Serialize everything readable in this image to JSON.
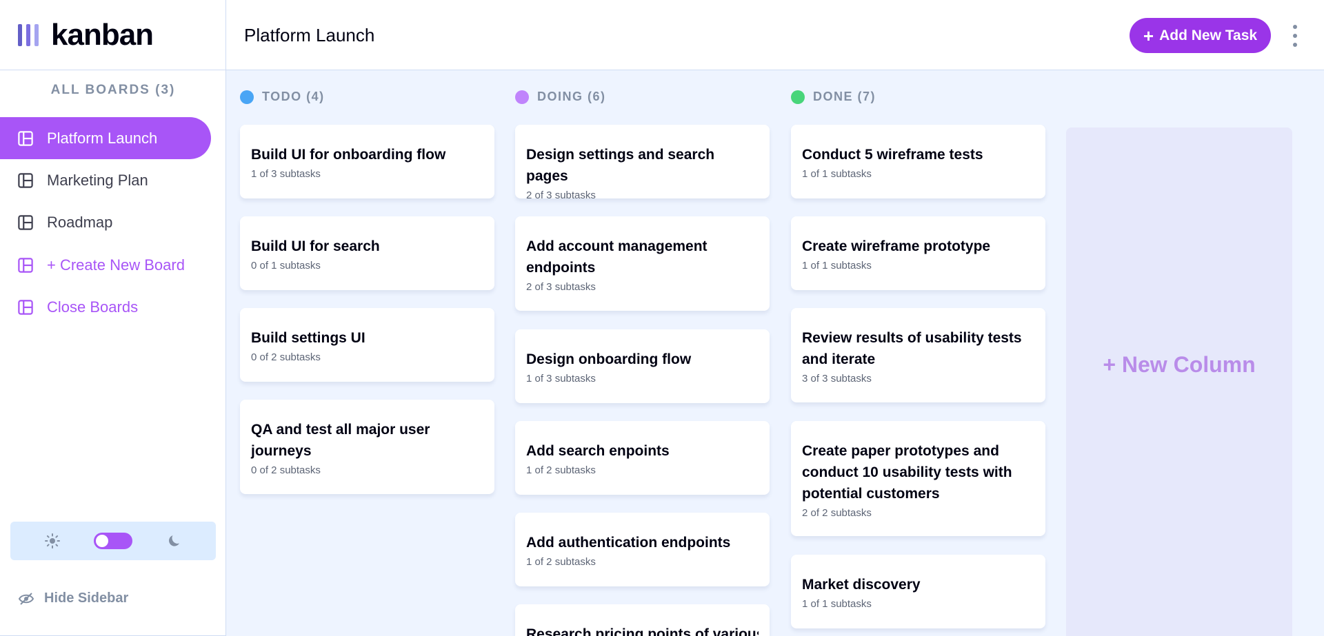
{
  "app": {
    "name": "kanban",
    "logo_colors": [
      "#635fc7",
      "#7c6fe0",
      "#a5a4f0"
    ]
  },
  "header": {
    "board_title": "Platform Launch",
    "add_task_label": "Add New Task",
    "add_task_icon": "plus-icon",
    "menu_icon": "vertical-ellipsis-icon"
  },
  "sidebar": {
    "heading": "ALL BOARDS (3)",
    "boards": [
      {
        "label": "Platform Launch",
        "active": true
      },
      {
        "label": "Marketing Plan",
        "active": false
      },
      {
        "label": "Roadmap",
        "active": false
      }
    ],
    "create_label": "+ Create New Board",
    "close_label": "Close Boards",
    "theme": {
      "light_icon": "sun-icon",
      "dark_icon": "moon-icon",
      "dark_mode_on": false
    },
    "hide_label": "Hide Sidebar"
  },
  "columns": [
    {
      "name": "TODO (4)",
      "color": "#49a5f5",
      "tasks": [
        {
          "title": "Build UI for onboarding flow",
          "subtasks": "1 of 3 subtasks"
        },
        {
          "title": "Build UI for search",
          "subtasks": "0 of 1 subtasks"
        },
        {
          "title": "Build settings UI",
          "subtasks": "0 of 2 subtasks"
        },
        {
          "title": "QA and test all major user journeys",
          "subtasks": "0 of 2 subtasks"
        }
      ]
    },
    {
      "name": "DOING (6)",
      "color": "#c084fc",
      "tasks": [
        {
          "title": "Design settings and search pages",
          "subtasks": "2 of 3 subtasks"
        },
        {
          "title": "Add account management endpoints",
          "subtasks": "2 of 3 subtasks"
        },
        {
          "title": "Design onboarding flow",
          "subtasks": "1 of 3 subtasks"
        },
        {
          "title": "Add search enpoints",
          "subtasks": "1 of 2 subtasks"
        },
        {
          "title": "Add authentication endpoints",
          "subtasks": "1 of 2 subtasks"
        },
        {
          "title": "Research pricing points of various",
          "subtasks": ""
        }
      ]
    },
    {
      "name": "DONE (7)",
      "color": "#48d57a",
      "tasks": [
        {
          "title": "Conduct 5 wireframe tests",
          "subtasks": "1 of 1 subtasks"
        },
        {
          "title": "Create wireframe prototype",
          "subtasks": "1 of 1 subtasks"
        },
        {
          "title": "Review results of usability tests and iterate",
          "subtasks": "3 of 3 subtasks"
        },
        {
          "title": "Create paper prototypes and conduct 10 usability tests with potential customers",
          "subtasks": "2 of 2 subtasks"
        },
        {
          "title": "Market discovery",
          "subtasks": "1 of 1 subtasks"
        }
      ]
    }
  ],
  "new_column_label": "+ New Column",
  "colors": {
    "accent": "#a855f7",
    "button": "#9a35e8",
    "muted": "#828fa3",
    "board_bg": "#eef4ff"
  }
}
